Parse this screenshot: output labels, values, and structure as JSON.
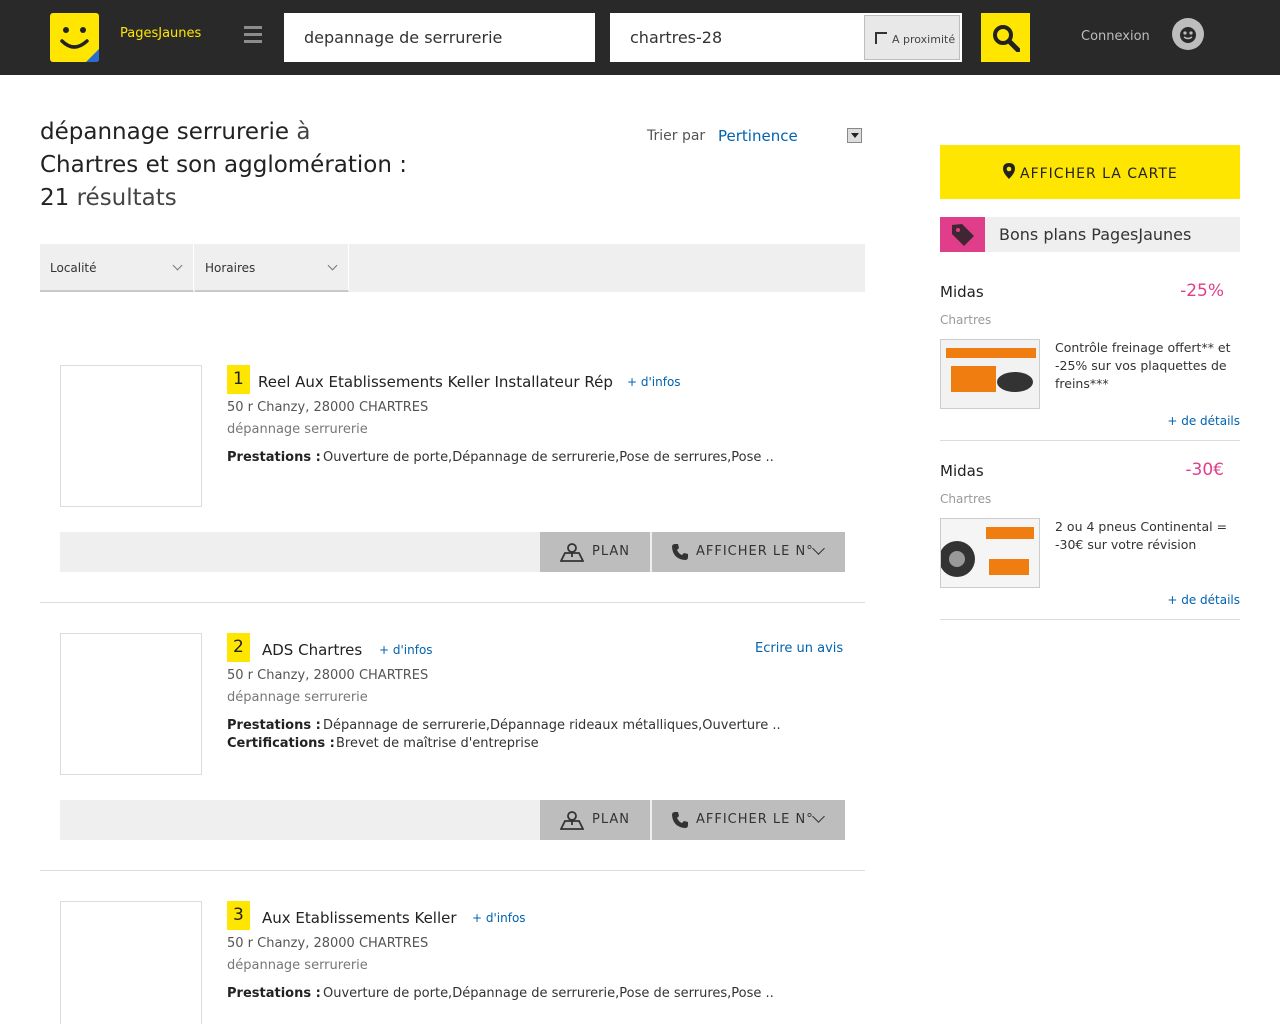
{
  "header": {
    "brand": "PagesJaunes",
    "what_value": "depannage de serrurerie",
    "where_value": "chartres-28",
    "proximity_label": "A proximité",
    "login_label": "Connexion"
  },
  "heading": {
    "activity": "dépannage serrurerie",
    "prep": "à",
    "place": "Chartres et son agglomération :",
    "count": "21",
    "results_label": "résultats"
  },
  "sort": {
    "label": "Trier par",
    "value": "Pertinence"
  },
  "filters": [
    {
      "label": "Localité"
    },
    {
      "label": "Horaires"
    }
  ],
  "results": [
    {
      "num": "1",
      "title": "Reel Aux Etablissements Keller Installateur Rép",
      "more": "+ d'infos",
      "address": "50 r Chanzy, 28000 CHARTRES",
      "category": "dépannage serrurerie",
      "prestations_label": "Prestations :",
      "prestations": "Ouverture de porte,Dépannage de serrurerie,Pose de serrures,Pose ..",
      "plan_label": "PLAN",
      "phone_label": "AFFICHER LE N°"
    },
    {
      "num": "2",
      "title": "ADS Chartres",
      "more": "+ d'infos",
      "review_link": "Ecrire un avis",
      "address": "50 r Chanzy, 28000 CHARTRES",
      "category": "dépannage serrurerie",
      "prestations_label": "Prestations :",
      "prestations": "Dépannage de serrurerie,Dépannage rideaux métalliques,Ouverture ..",
      "certifications_label": "Certifications :",
      "certifications": "Brevet de maîtrise d'entreprise",
      "plan_label": "PLAN",
      "phone_label": "AFFICHER LE N°"
    },
    {
      "num": "3",
      "title": "Aux Etablissements Keller",
      "more": "+ d'infos",
      "address": "50 r Chanzy, 28000 CHARTRES",
      "category": "dépannage serrurerie",
      "prestations_label": "Prestations :",
      "prestations": "Ouverture de porte,Dépannage de serrurerie,Pose de serrures,Pose .."
    }
  ],
  "sidebar": {
    "map_label": "AFFICHER LA CARTE",
    "deals_title": "Bons plans PagesJaunes",
    "deals": [
      {
        "name": "Midas",
        "discount": "-25%",
        "city": "Chartres",
        "description": "Contrôle freinage offert** et -25% sur vos plaquettes de freins***",
        "more": "+ de détails"
      },
      {
        "name": "Midas",
        "discount": "-30€",
        "city": "Chartres",
        "description": "2 ou 4 pneus Continental = -30€ sur votre révision",
        "more": "+ de détails"
      }
    ]
  },
  "colors": {
    "brand_yellow": "#ffe600",
    "header_bg": "#292929",
    "link_blue": "#0062b0",
    "accent_pink": "#e03e8a"
  }
}
